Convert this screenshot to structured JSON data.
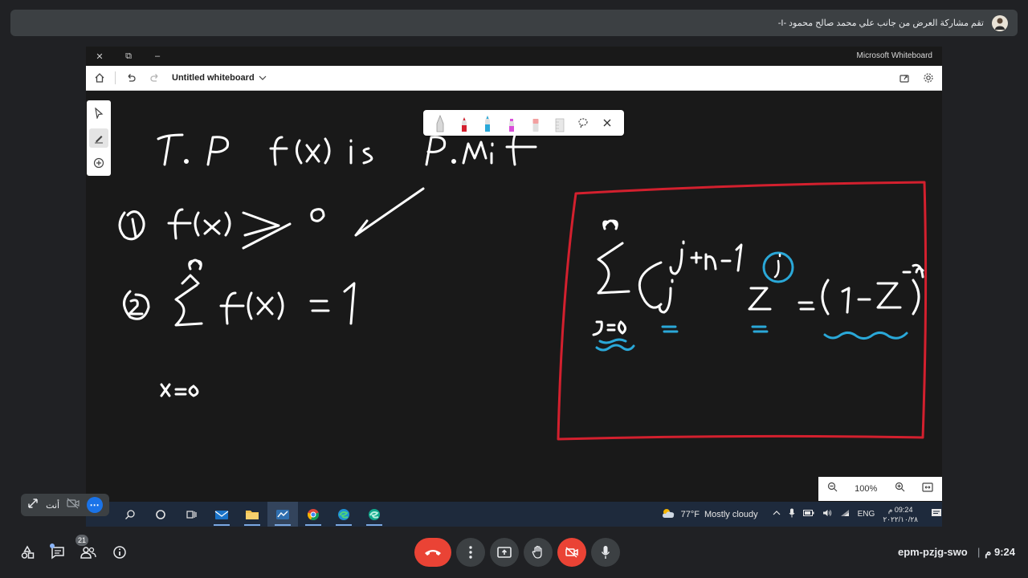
{
  "banner": {
    "text": "تقم مشاركة العرض من جانب علي محمد صالح محمود -I-"
  },
  "shared_window": {
    "app_name": "Microsoft Whiteboard",
    "board_title": "Untitled whiteboard",
    "zoom": "100%"
  },
  "whiteboard_ink": {
    "line1": "T.P f(x) is p.m.f",
    "cond1": "① f(x) ≥ 0 ✓",
    "cond2": "② Σ f(x) = 1",
    "cond2_upper": "∞",
    "cond2_lower": "x=0",
    "boxed": {
      "formula": "Σ C(j+n-1, j) z^j = (1-z)^-n",
      "sum_upper": "∞",
      "sum_lower": "j=0",
      "choose_top": "j+n-1",
      "choose_bottom": "j",
      "z_power": "j",
      "rhs": "= (1 −z)",
      "rhs_power": "-n"
    },
    "colors": {
      "ink": "#ffffff",
      "highlight": "#2aa8d8",
      "box": "#d3202e"
    }
  },
  "taskbar": {
    "weather_temp": "77°F",
    "weather_desc": "Mostly cloudy",
    "language": "ENG",
    "time": "09:24 م",
    "date": "٢٠٢٢/١٠/٢٨"
  },
  "self_view": {
    "label": "أنت"
  },
  "meeting": {
    "participant_count": "21",
    "code": "epm-pzjg-swo",
    "separator": "|",
    "time": "9:24 م"
  }
}
